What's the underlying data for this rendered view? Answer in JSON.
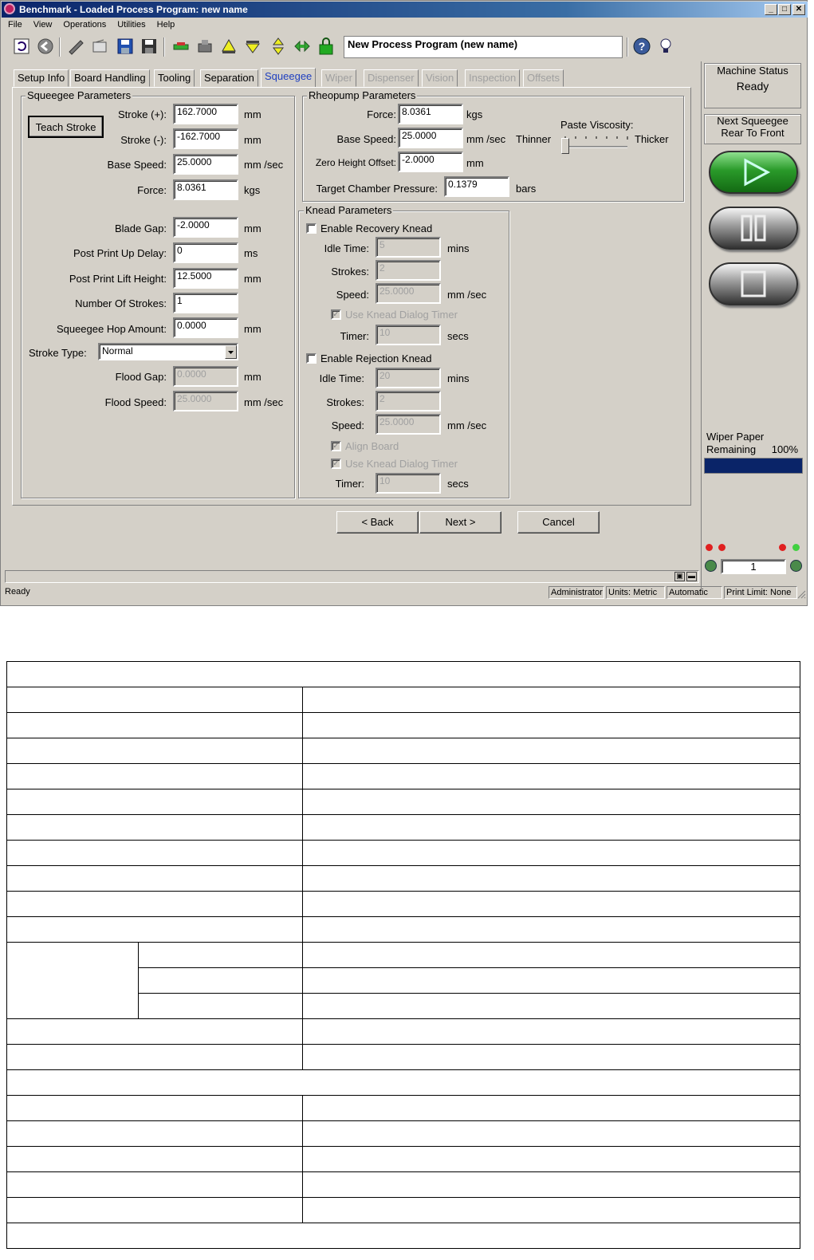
{
  "window": {
    "title": "Benchmark - Loaded Process Program:  new name",
    "min": "_",
    "max": "□",
    "close": "✕"
  },
  "menu": [
    "File",
    "View",
    "Operations",
    "Utilities",
    "Help"
  ],
  "toolbar": {
    "process_program_name": "New Process Program (new name)"
  },
  "tabs": [
    {
      "label": "Setup Info",
      "enabled": true
    },
    {
      "label": "Board Handling",
      "enabled": true
    },
    {
      "label": "Tooling",
      "enabled": true
    },
    {
      "label": "Separation",
      "enabled": true
    },
    {
      "label": "Squeegee",
      "enabled": true,
      "selected": true
    },
    {
      "label": "Wiper",
      "enabled": false
    },
    {
      "label": "Dispenser",
      "enabled": false
    },
    {
      "label": "Vision",
      "enabled": false
    },
    {
      "label": "Inspection",
      "enabled": false
    },
    {
      "label": "Offsets",
      "enabled": false
    }
  ],
  "squeegee": {
    "title": "Squeegee Parameters",
    "teach_stroke": "Teach Stroke",
    "stroke_plus": {
      "label": "Stroke (+):",
      "value": "162.7000",
      "unit": "mm"
    },
    "stroke_minus": {
      "label": "Stroke (-):",
      "value": "-162.7000",
      "unit": "mm"
    },
    "base_speed": {
      "label": "Base Speed:",
      "value": "25.0000",
      "unit": "mm /sec"
    },
    "force": {
      "label": "Force:",
      "value": "8.0361",
      "unit": "kgs"
    },
    "blade_gap": {
      "label": "Blade Gap:",
      "value": "-2.0000",
      "unit": "mm"
    },
    "post_print_up_delay": {
      "label": "Post Print Up Delay:",
      "value": "0",
      "unit": "ms"
    },
    "post_print_lift_height": {
      "label": "Post Print Lift Height:",
      "value": "12.5000",
      "unit": "mm"
    },
    "number_of_strokes": {
      "label": "Number Of Strokes:",
      "value": "1"
    },
    "hop_amount": {
      "label": "Squeegee Hop Amount:",
      "value": "0.0000",
      "unit": "mm"
    },
    "stroke_type": {
      "label": "Stroke Type:",
      "value": "Normal"
    },
    "flood_gap": {
      "label": "Flood Gap:",
      "value": "0.0000",
      "unit": "mm"
    },
    "flood_speed": {
      "label": "Flood Speed:",
      "value": "25.0000",
      "unit": "mm /sec"
    }
  },
  "rheopump": {
    "title": "Rheopump Parameters",
    "force": {
      "label": "Force:",
      "value": "8.0361",
      "unit": "kgs"
    },
    "base_speed": {
      "label": "Base Speed:",
      "value": "25.0000",
      "unit": "mm /sec"
    },
    "zero_height_offset": {
      "label": "Zero Height Offset:",
      "value": "-2.0000",
      "unit": "mm"
    },
    "target_chamber_pressure": {
      "label": "Target Chamber Pressure:",
      "value": "0.1379",
      "unit": "bars"
    },
    "paste_viscosity": {
      "label": "Paste Viscosity:",
      "thinner": "Thinner",
      "thicker": "Thicker",
      "level": 0.0
    }
  },
  "knead": {
    "title": "Knead Parameters",
    "recovery": {
      "enable_label": "Enable Recovery Knead",
      "enabled": false,
      "idle_time": {
        "label": "Idle Time:",
        "value": "5",
        "unit": "mins"
      },
      "strokes": {
        "label": "Strokes:",
        "value": "2"
      },
      "speed": {
        "label": "Speed:",
        "value": "25.0000",
        "unit": "mm /sec"
      },
      "use_timer": {
        "label": "Use Knead Dialog Timer",
        "checked": true
      },
      "timer": {
        "label": "Timer:",
        "value": "10",
        "unit": "secs"
      }
    },
    "rejection": {
      "enable_label": "Enable Rejection Knead",
      "enabled": false,
      "idle_time": {
        "label": "Idle Time:",
        "value": "20",
        "unit": "mins"
      },
      "strokes": {
        "label": "Strokes:",
        "value": "2"
      },
      "speed": {
        "label": "Speed:",
        "value": "25.0000",
        "unit": "mm /sec"
      },
      "align_board": {
        "label": "Align Board",
        "checked": true
      },
      "use_timer": {
        "label": "Use Knead Dialog Timer",
        "checked": true
      },
      "timer": {
        "label": "Timer:",
        "value": "10",
        "unit": "secs"
      }
    }
  },
  "nav": {
    "back": "< Back",
    "next": "Next >",
    "cancel": "Cancel"
  },
  "side": {
    "machine_status_label": "Machine Status",
    "machine_status": "Ready",
    "next_squeegee_label": "Next Squeegee",
    "next_squeegee": "Rear To Front",
    "wiper_paper_label": "Wiper Paper",
    "wiper_remaining_label": "Remaining",
    "wiper_percent": "100%",
    "wiper_level": 1.0,
    "counter": "1"
  },
  "statusbar": {
    "status": "Ready",
    "user": "Administrator",
    "units": "Units: Metric",
    "mode": "Automatic",
    "print_limit": "Print Limit: None"
  },
  "colors": {
    "play": "#2a9a2a",
    "title_bar": "#0a246a",
    "progress": "#0a2468"
  }
}
